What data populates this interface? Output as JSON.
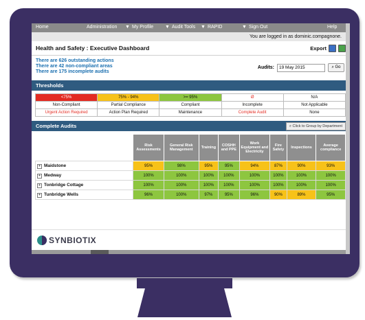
{
  "nav": {
    "home": "Home",
    "administration": "Administration",
    "my_profile": "My Profile",
    "audit_tools": "Audit Tools",
    "rapid": "RAPID",
    "sign_out": "Sign Out",
    "help": "Help",
    "logged_in": "You are logged in as dominic.compagnone."
  },
  "dashboard": {
    "title": "Health and Safety : Executive Dashboard",
    "export_label": "Export",
    "summary": [
      "There are 626 outstanding actions",
      "There are 42 non-compliant areas",
      "There are 175 incomplete audits"
    ],
    "audits_label": "Audits:",
    "audits_date": "19 May 2015",
    "go_label": "Go"
  },
  "thresholds": {
    "title": "Thresholds",
    "headers": [
      "<75%",
      "75% - 94%",
      ">= 95%",
      "Ø",
      "N/A"
    ],
    "status": [
      "Non-Compliant",
      "Partial Compliance",
      "Compliant",
      "Incomplete",
      "Not Applicable"
    ],
    "actions": [
      "Urgent Action Required",
      "Action Plan Required",
      "Maintenance",
      "Complete Audit",
      "None"
    ]
  },
  "complete_audits": {
    "title": "Complete Audits",
    "group_button": "Click to Group by Department",
    "columns": [
      "Risk Assessments",
      "General Risk Management",
      "Training",
      "COSHH and PPE",
      "Work Equipment and Electricity",
      "Fire Safety",
      "Inspections",
      "Average compliance"
    ],
    "rows": [
      {
        "name": "Maidstone",
        "values": [
          "95%",
          "98%",
          "95%",
          "95%",
          "94%",
          "87%",
          "90%",
          "93%"
        ]
      },
      {
        "name": "Medway",
        "values": [
          "100%",
          "100%",
          "100%",
          "100%",
          "100%",
          "100%",
          "100%",
          "100%"
        ]
      },
      {
        "name": "Tonbridge Cottage",
        "values": [
          "100%",
          "100%",
          "100%",
          "100%",
          "100%",
          "100%",
          "100%",
          "100%"
        ]
      },
      {
        "name": "Tunbridge Wells",
        "values": [
          "96%",
          "100%",
          "97%",
          "95%",
          "96%",
          "90%",
          "89%",
          "95%"
        ]
      }
    ],
    "cell_colors": [
      [
        "yellow",
        "green",
        "yellow",
        "green",
        "yellow",
        "yellow",
        "yellow",
        "yellow"
      ],
      [
        "green",
        "green",
        "green",
        "green",
        "green",
        "green",
        "green",
        "green"
      ],
      [
        "green",
        "green",
        "green",
        "green",
        "green",
        "green",
        "green",
        "green"
      ],
      [
        "green",
        "green",
        "green",
        "green",
        "green",
        "yellow",
        "yellow",
        "green"
      ]
    ]
  },
  "brand": {
    "logo_text": "SYNBIOTIX"
  },
  "colors": {
    "monitor": "#3b2f63",
    "header_blue": "#2f5b80",
    "compliant_green": "#8dc63f",
    "partial_yellow": "#f7c219",
    "noncompliant_red": "#e32b22"
  }
}
